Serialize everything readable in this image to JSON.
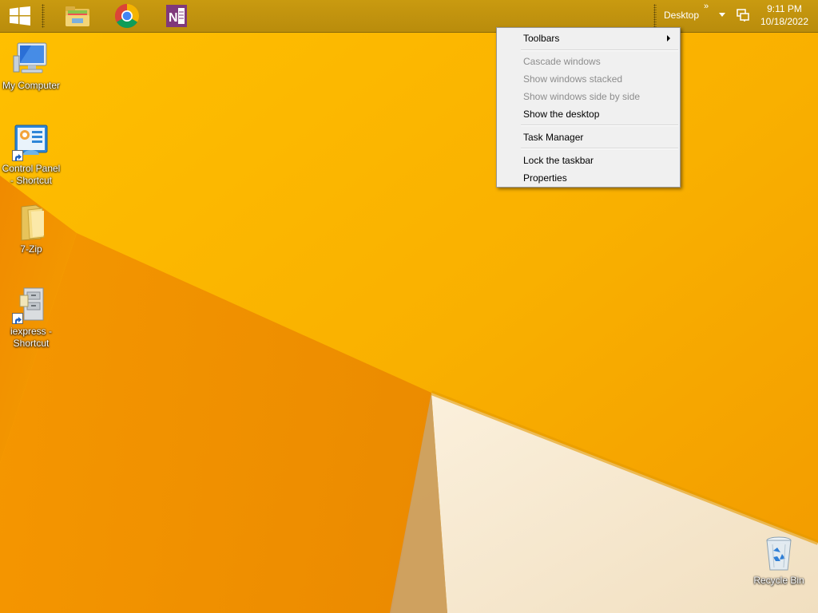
{
  "taskbar": {
    "toolbar_label": "Desktop",
    "overflow_chevron": "»",
    "clock": {
      "time": "9:11 PM",
      "date": "10/18/2022"
    },
    "pinned": [
      {
        "name": "file-explorer",
        "icon": "folder-icon"
      },
      {
        "name": "chrome",
        "icon": "chrome-icon"
      },
      {
        "name": "onenote",
        "icon": "onenote-icon"
      }
    ]
  },
  "desktop_icons": [
    {
      "label_lines": [
        "My Computer"
      ],
      "icon": "computer-icon"
    },
    {
      "label_lines": [
        "Control Panel",
        "- Shortcut"
      ],
      "icon": "control-panel-icon"
    },
    {
      "label_lines": [
        "7-Zip"
      ],
      "icon": "folder-icon"
    },
    {
      "label_lines": [
        "iexpress -",
        "Shortcut"
      ],
      "icon": "cabinet-icon"
    },
    {
      "label_lines": [
        "Recycle Bin"
      ],
      "icon": "recycle-bin-icon"
    }
  ],
  "context_menu": {
    "items": [
      {
        "label": "Toolbars",
        "enabled": true,
        "submenu": true
      },
      {
        "label": "Cascade windows",
        "enabled": false
      },
      {
        "label": "Show windows stacked",
        "enabled": false
      },
      {
        "label": "Show windows side by side",
        "enabled": false
      },
      {
        "label": "Show the desktop",
        "enabled": true
      },
      {
        "label": "Task Manager",
        "enabled": true
      },
      {
        "label": "Lock the taskbar",
        "enabled": true
      },
      {
        "label": "Properties",
        "enabled": true
      }
    ]
  },
  "colors": {
    "wallpaper_orange": "#f7a800",
    "taskbar": "#c2940e",
    "menu_bg": "#f0f0f0",
    "disabled_text": "#8d8d8d"
  }
}
